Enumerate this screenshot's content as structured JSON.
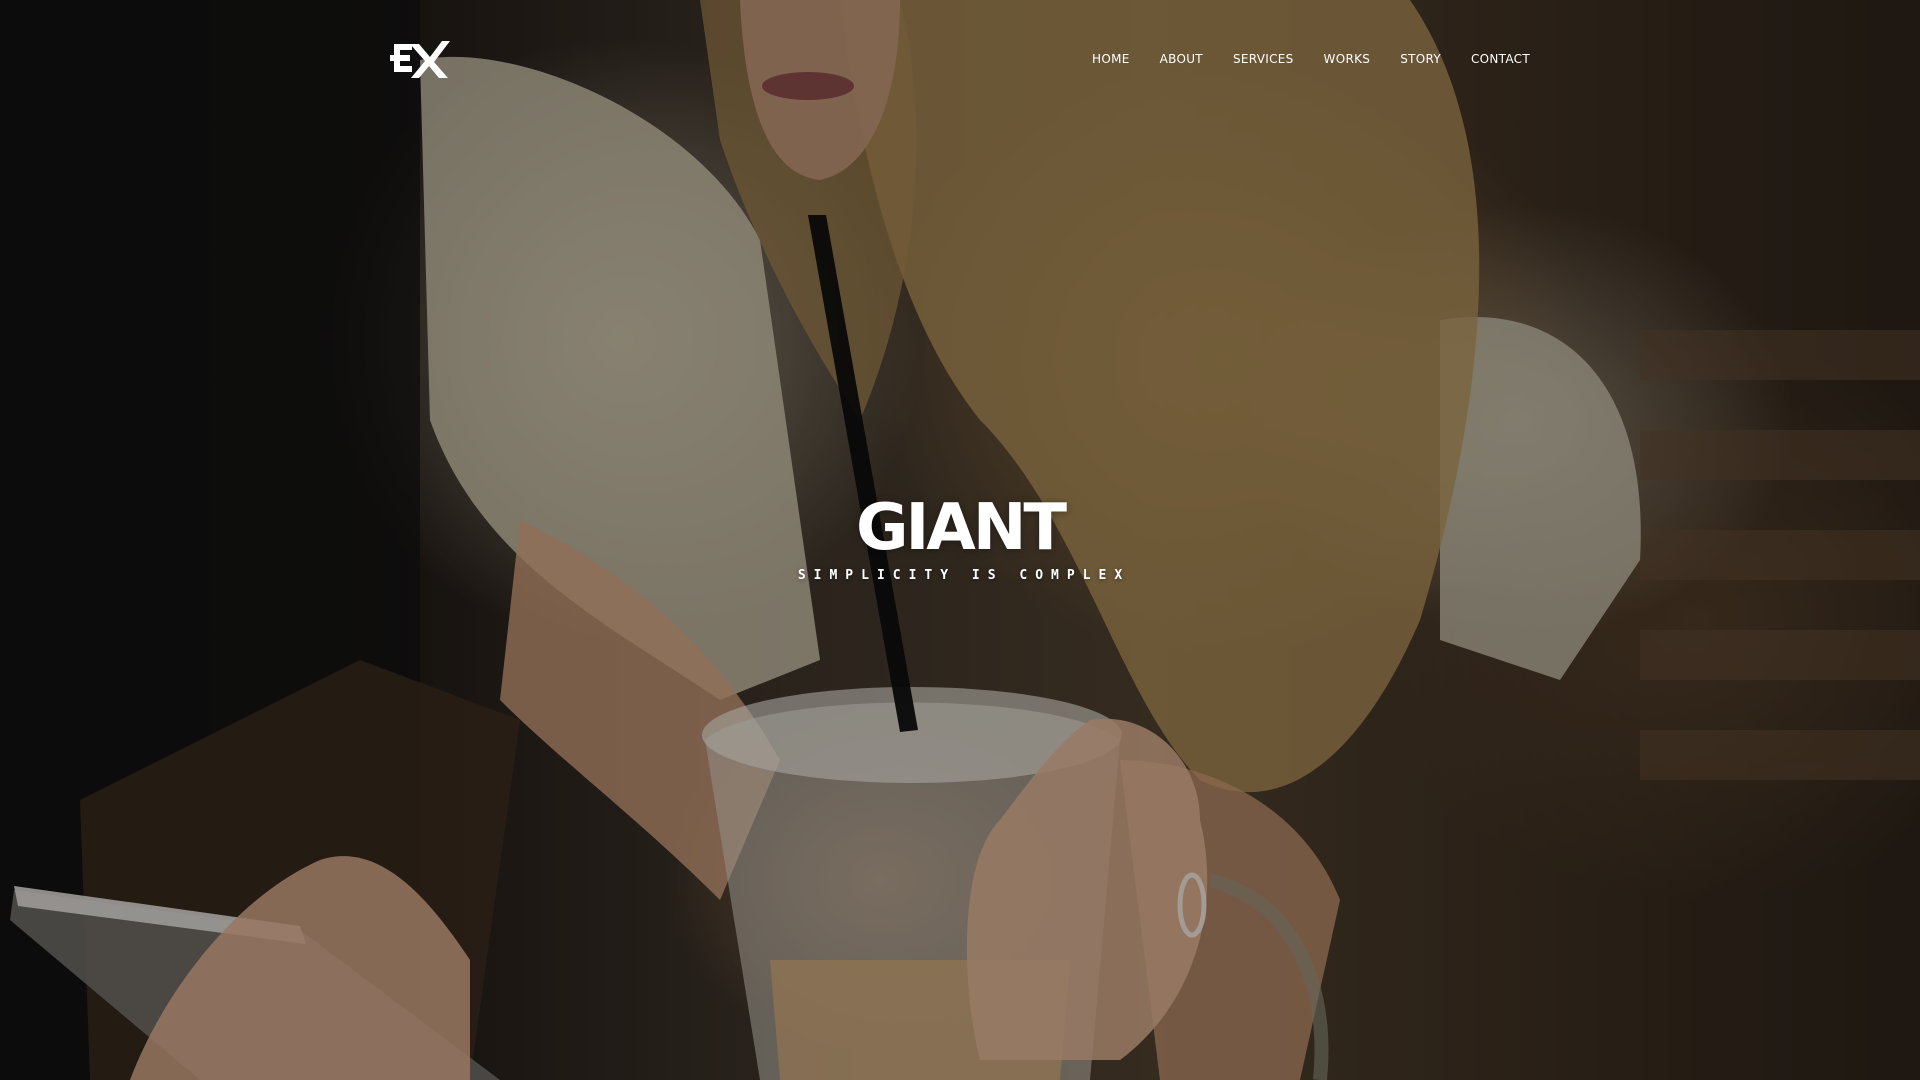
{
  "brand": {
    "logo_text": "EX",
    "icon": "ex-logo-icon"
  },
  "nav": {
    "items": [
      {
        "label": "HOME"
      },
      {
        "label": "ABOUT"
      },
      {
        "label": "SERVICES"
      },
      {
        "label": "WORKS"
      },
      {
        "label": "STORY"
      },
      {
        "label": "CONTACT"
      }
    ]
  },
  "hero": {
    "title": "GIANT",
    "subtitle": "SIMPLICITY IS COMPLEX",
    "background_image": "woman-drinking-iced-coffee-with-phone"
  },
  "colors": {
    "text": "#ffffff",
    "overlay": "#000000"
  }
}
